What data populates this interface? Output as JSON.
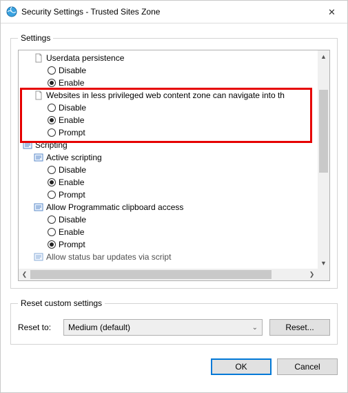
{
  "window": {
    "title": "Security Settings - Trusted Sites Zone"
  },
  "buttons": {
    "ok": "OK",
    "cancel": "Cancel",
    "reset": "Reset...",
    "close_glyph": "✕"
  },
  "groups": {
    "settings": "Settings",
    "reset_custom": "Reset custom settings"
  },
  "reset": {
    "label": "Reset to:",
    "selected": "Medium (default)"
  },
  "scroll": {
    "up": "▲",
    "down": "▼",
    "left": "❮",
    "right": "❯"
  },
  "combo_chevron": "⌄",
  "tree": {
    "userdata_persistence": {
      "label": "Userdata persistence",
      "options": {
        "disable": "Disable",
        "enable": "Enable"
      },
      "selected": "enable"
    },
    "websites_less_priv": {
      "label": "Websites in less privileged web content zone can navigate into th",
      "options": {
        "disable": "Disable",
        "enable": "Enable",
        "prompt": "Prompt"
      },
      "selected": "enable",
      "highlighted": true
    },
    "scripting_header": "Scripting",
    "active_scripting": {
      "label": "Active scripting",
      "options": {
        "disable": "Disable",
        "enable": "Enable",
        "prompt": "Prompt"
      },
      "selected": "enable"
    },
    "prog_clipboard": {
      "label": "Allow Programmatic clipboard access",
      "options": {
        "disable": "Disable",
        "enable": "Enable",
        "prompt": "Prompt"
      },
      "selected": "prompt"
    },
    "statusbar_updates": {
      "label": "Allow status bar updates via script"
    }
  }
}
